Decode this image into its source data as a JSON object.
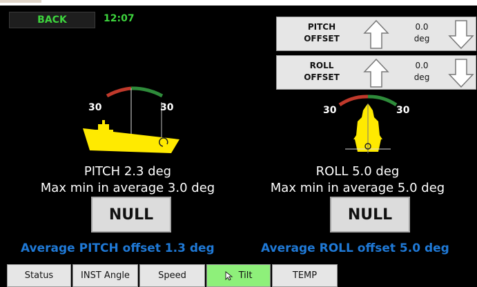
{
  "header": {
    "back_label": "BACK",
    "time": "12:07"
  },
  "pitch_offset": {
    "label_line1": "PITCH",
    "label_line2": "OFFSET",
    "value": "0.0",
    "unit": "deg"
  },
  "roll_offset": {
    "label_line1": "ROLL",
    "label_line2": "OFFSET",
    "value": "0.0",
    "unit": "deg"
  },
  "pitch": {
    "scale_left": "30",
    "scale_right": "30",
    "reading": "PITCH 2.3 deg",
    "maxmin": "Max min in average 3.0 deg",
    "null_label": "NULL",
    "average": "Average PITCH offset 1.3 deg"
  },
  "roll": {
    "scale_left": "30",
    "scale_right": "30",
    "reading": "ROLL 5.0 deg",
    "maxmin": "Max min in average 5.0 deg",
    "null_label": "NULL",
    "average": "Average ROLL offset 5.0 deg"
  },
  "tabs": [
    {
      "label": "Status"
    },
    {
      "label": "INST Angle"
    },
    {
      "label": "Speed"
    },
    {
      "label": "Tilt"
    },
    {
      "label": "TEMP"
    }
  ],
  "colors": {
    "accent_green": "#3dd43d",
    "average_blue": "#1f79d6",
    "vessel_yellow": "#ffea00",
    "active_tab": "#8ef07a"
  }
}
